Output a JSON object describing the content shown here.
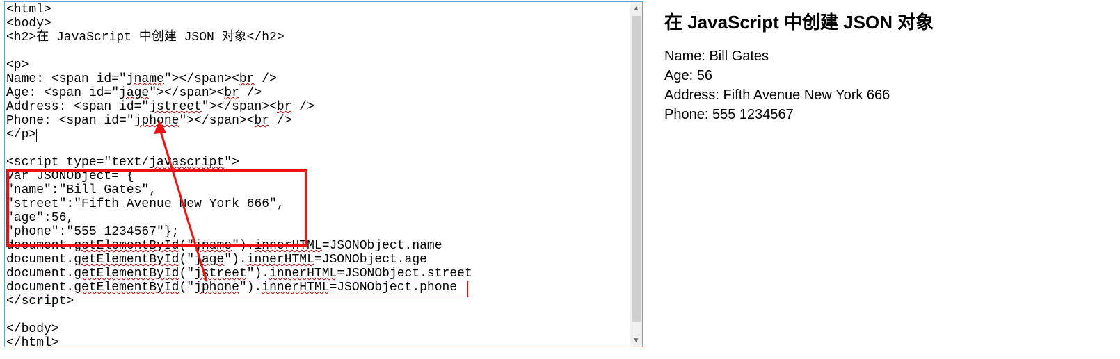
{
  "editor": {
    "lines": [
      "<html>",
      "<body>",
      "<h2>在 JavaScript 中创建 JSON 对象</h2>",
      "",
      "<p>",
      "Name: <span id=\"jname\"></span><br />",
      "Age: <span id=\"jage\"></span><br />",
      "Address: <span id=\"jstreet\"></span><br />",
      "Phone: <span id=\"jphone\"></span><br />",
      "</p>",
      "",
      "<script type=\"text/javascript\">",
      "var JSONObject= {",
      "\"name\":\"Bill Gates\",",
      "\"street\":\"Fifth Avenue New York 666\",",
      "\"age\":56,",
      "\"phone\":\"555 1234567\"};",
      "document.getElementById(\"jname\").innerHTML=JSONObject.name",
      "document.getElementById(\"jage\").innerHTML=JSONObject.age",
      "document.getElementById(\"jstreet\").innerHTML=JSONObject.street",
      "document.getElementById(\"jphone\").innerHTML=JSONObject.phone",
      "</script>",
      "",
      "</body>",
      "</html>"
    ],
    "wavy_tokens": [
      "jname",
      "br",
      "jage",
      "jstreet",
      "jphone",
      "javascript",
      "getElementById",
      "innerHTML"
    ]
  },
  "preview": {
    "heading": "在 JavaScript 中创建 JSON 对象",
    "name_label": "Name: ",
    "name_value": "Bill Gates",
    "age_label": "Age: ",
    "age_value": "56",
    "address_label": "Address: ",
    "address_value": "Fifth Avenue New York 666",
    "phone_label": "Phone: ",
    "phone_value": "555 1234567"
  }
}
